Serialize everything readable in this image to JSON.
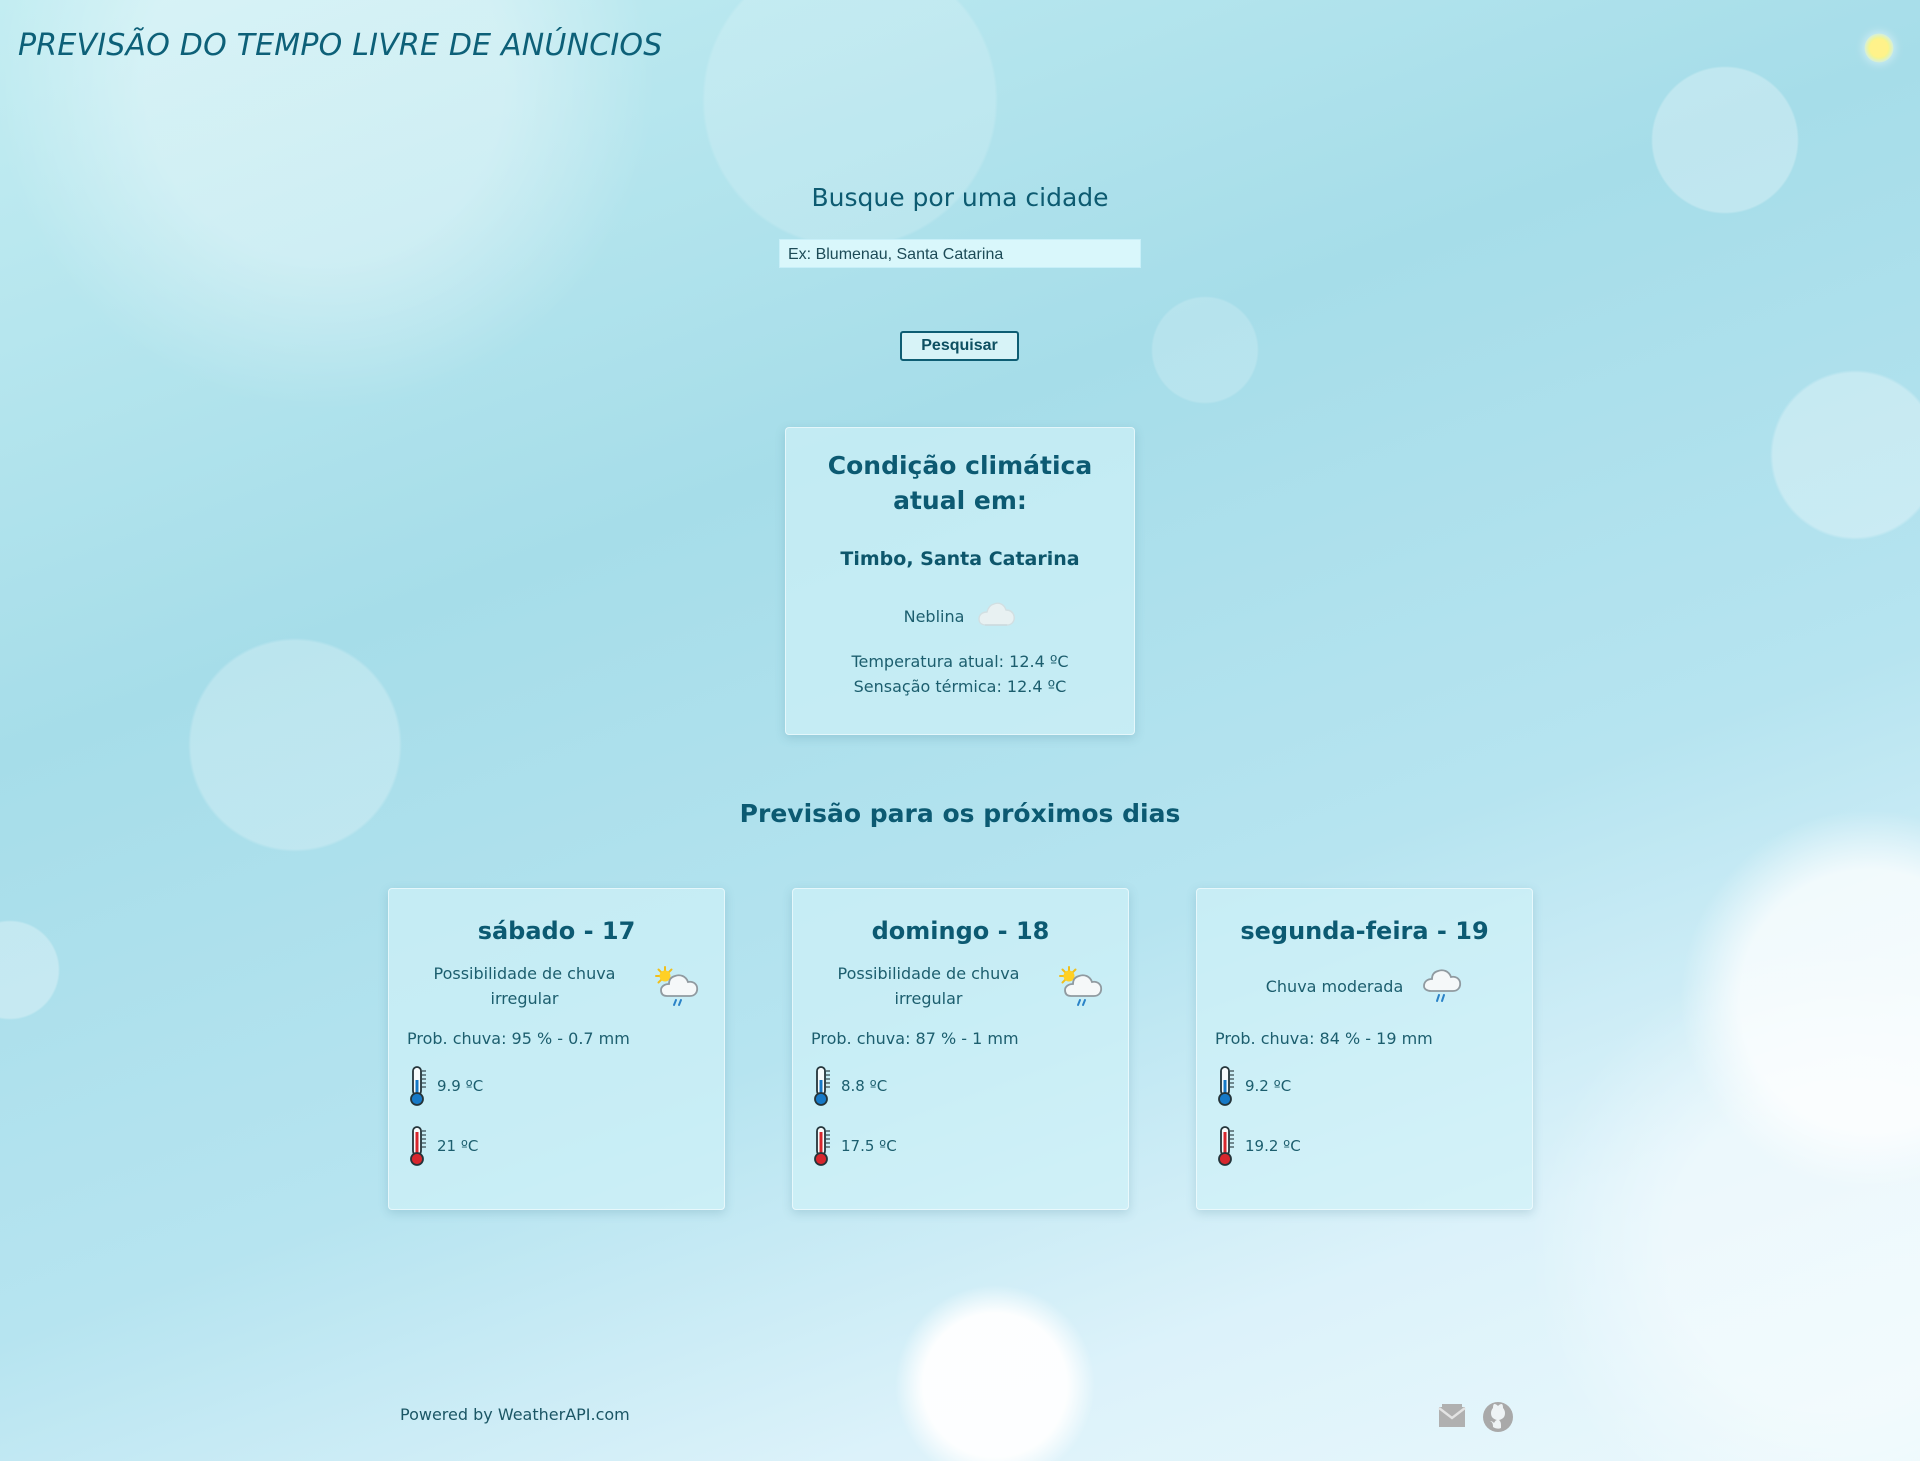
{
  "header": {
    "title": "PREVISÃO DO TEMPO LIVRE DE ANÚNCIOS",
    "theme_icon": "sun-icon"
  },
  "search": {
    "title": "Busque por uma cidade",
    "placeholder": "Ex: Blumenau, Santa Catarina",
    "button_label": "Pesquisar"
  },
  "current": {
    "heading": "Condição climática atual em:",
    "location": "Timbo, Santa Catarina",
    "condition": "Neblina",
    "condition_icon": "fog-cloud-icon",
    "temperature": "Temperatura atual: 12.4 ºC",
    "feels_like": "Sensação térmica: 12.4 ºC"
  },
  "forecast": {
    "title": "Previsão para os próximos dias",
    "days": [
      {
        "name": "sábado - 17",
        "condition": "Possibilidade de chuva irregular",
        "icon": "sun-cloud-rain-icon",
        "rain": "Prob. chuva: 95 % - 0.7 mm",
        "min": "9.9 ºC",
        "max": "21 ºC"
      },
      {
        "name": "domingo - 18",
        "condition": "Possibilidade de chuva irregular",
        "icon": "sun-cloud-rain-icon",
        "rain": "Prob. chuva: 87 % - 1 mm",
        "min": "8.8 ºC",
        "max": "17.5 ºC"
      },
      {
        "name": "segunda-feira - 19",
        "condition": "Chuva moderada",
        "icon": "cloud-rain-icon",
        "rain": "Prob. chuva: 84 % - 19 mm",
        "min": "9.2 ºC",
        "max": "19.2 ºC"
      }
    ]
  },
  "footer": {
    "credit": "Powered by WeatherAPI.com",
    "icons": [
      "mail-icon",
      "github-icon"
    ]
  },
  "colors": {
    "primary_text": "#0c5a72",
    "body_text": "#1c5e6e",
    "button_border": "#0e5d73",
    "card_background": "#d0f2f8",
    "cold_thermometer": "#1679c7",
    "hot_thermometer": "#d7262d"
  }
}
